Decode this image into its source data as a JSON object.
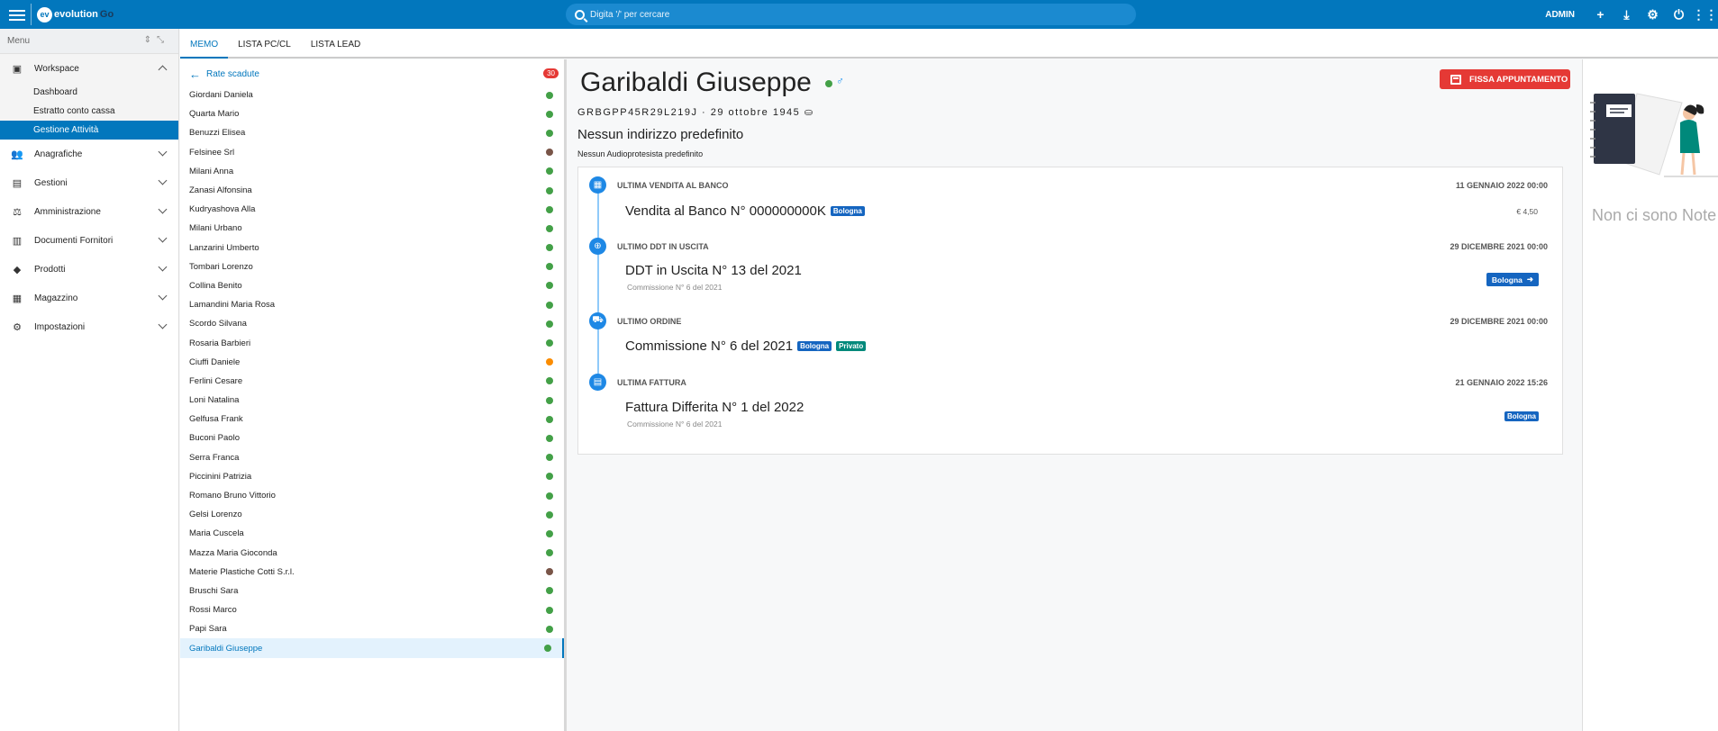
{
  "topbar": {
    "logo_text": "evolution",
    "logo_suffix": "Go",
    "logo_mark": "ev",
    "search_placeholder": "Digita '/' per cercare",
    "user": "ADMIN"
  },
  "sidebar": {
    "menu_label": "Menu",
    "items": [
      {
        "label": "Workspace",
        "icon": "monitor-icon",
        "glyph": "▣",
        "open": true,
        "subitems": [
          {
            "label": "Dashboard"
          },
          {
            "label": "Estratto conto cassa"
          },
          {
            "label": "Gestione Attività",
            "active": true
          }
        ]
      },
      {
        "label": "Anagrafiche",
        "icon": "users-icon",
        "glyph": "👥"
      },
      {
        "label": "Gestioni",
        "icon": "clipboard-icon",
        "glyph": "▤"
      },
      {
        "label": "Amministrazione",
        "icon": "scale-icon",
        "glyph": "⚖"
      },
      {
        "label": "Documenti Fornitori",
        "icon": "factory-icon",
        "glyph": "▥"
      },
      {
        "label": "Prodotti",
        "icon": "tag-icon",
        "glyph": "◆"
      },
      {
        "label": "Magazzino",
        "icon": "store-icon",
        "glyph": "▦"
      },
      {
        "label": "Impostazioni",
        "icon": "gear-icon",
        "glyph": "⚙"
      }
    ]
  },
  "tabs": [
    {
      "label": "MEMO",
      "active": true
    },
    {
      "label": "LISTA PC/CL"
    },
    {
      "label": "LISTA LEAD"
    }
  ],
  "list": {
    "back_label": "Rate scadute",
    "badge": "30",
    "rows": [
      {
        "name": "Giordani Daniela",
        "status": "#43a047"
      },
      {
        "name": "Quarta Mario",
        "status": "#43a047"
      },
      {
        "name": "Benuzzi Elisea",
        "status": "#43a047"
      },
      {
        "name": "Felsinee Srl",
        "status": "#795548"
      },
      {
        "name": "Milani Anna",
        "status": "#43a047"
      },
      {
        "name": "Zanasi Alfonsina",
        "status": "#43a047"
      },
      {
        "name": "Kudryashova Alla",
        "status": "#43a047"
      },
      {
        "name": "Milani Urbano",
        "status": "#43a047"
      },
      {
        "name": "Lanzarini Umberto",
        "status": "#43a047"
      },
      {
        "name": "Tombari Lorenzo",
        "status": "#43a047"
      },
      {
        "name": "Collina Benito",
        "status": "#43a047"
      },
      {
        "name": "Lamandini Maria Rosa",
        "status": "#43a047"
      },
      {
        "name": "Scordo Silvana",
        "status": "#43a047"
      },
      {
        "name": "Rosaria Barbieri",
        "status": "#43a047"
      },
      {
        "name": "Ciuffi Daniele",
        "status": "#fb8c00"
      },
      {
        "name": "Ferlini Cesare",
        "status": "#43a047"
      },
      {
        "name": "Loni Natalina",
        "status": "#43a047"
      },
      {
        "name": "Gelfusa Frank",
        "status": "#43a047"
      },
      {
        "name": "Buconi Paolo",
        "status": "#43a047"
      },
      {
        "name": "Serra Franca",
        "status": "#43a047"
      },
      {
        "name": "Piccinini Patrizia",
        "status": "#43a047"
      },
      {
        "name": "Romano Bruno Vittorio",
        "status": "#43a047"
      },
      {
        "name": "Gelsi Lorenzo",
        "status": "#43a047"
      },
      {
        "name": "Maria Cuscela",
        "status": "#43a047"
      },
      {
        "name": "Mazza Maria Gioconda",
        "status": "#43a047"
      },
      {
        "name": "Materie Plastiche Cotti S.r.l.",
        "status": "#795548"
      },
      {
        "name": "Bruschi Sara",
        "status": "#43a047"
      },
      {
        "name": "Rossi Marco",
        "status": "#43a047"
      },
      {
        "name": "Papi Sara",
        "status": "#43a047"
      },
      {
        "name": "Garibaldi Giuseppe",
        "status": "#43a047",
        "selected": true
      }
    ]
  },
  "detail": {
    "name": "Garibaldi Giuseppe",
    "gender_symbol": "♂",
    "code_line": "GRBGPP45R29L219J · 29 ottobre 1945",
    "address": "Nessun indirizzo predefinito",
    "audio": "Nessun Audioprotesista predefinito",
    "action_label": "FISSA APPUNTAMENTO",
    "timeline": {
      "vendita": {
        "label": "ULTIMA VENDITA AL BANCO",
        "date": "11 GENNAIO 2022 00:00",
        "title": "Vendita al Banco N° 000000000K",
        "tag": "Bologna",
        "amount": "€ 4,50"
      },
      "ddt": {
        "label": "ULTIMO DDT IN USCITA",
        "date": "29 DICEMBRE 2021 00:00",
        "title": "DDT in Uscita N° 13 del 2021",
        "sub": "Commissione N° 6 del 2021",
        "button": "Bologna"
      },
      "ordine": {
        "label": "ULTIMO ORDINE",
        "date": "29 DICEMBRE 2021 00:00",
        "title": "Commissione N° 6 del 2021",
        "tag1": "Bologna",
        "tag2": "Privato"
      },
      "fattura": {
        "label": "ULTIMA FATTURA",
        "date": "21 GENNAIO 2022 15:26",
        "title": "Fattura Differita N° 1 del 2022",
        "sub": "Commissione N° 6 del 2021",
        "tag": "Bologna"
      }
    }
  },
  "notes": {
    "empty_text": "Non ci sono Note"
  }
}
